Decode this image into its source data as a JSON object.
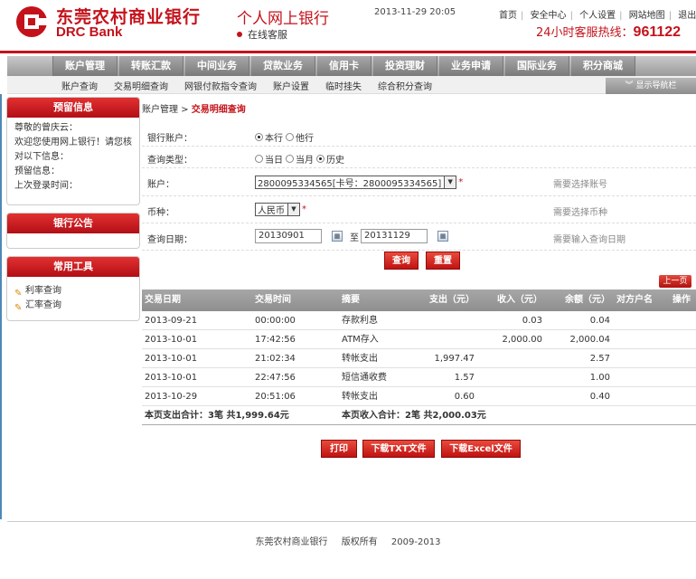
{
  "header": {
    "logo_cn": "东莞农村商业银行",
    "logo_en": "DRC Bank",
    "title": "个人网上银行",
    "online_service": "在线客服",
    "datetime": "2013-11-29  20:05",
    "links": [
      "首页",
      "安全中心",
      "个人设置",
      "网站地图",
      "退出"
    ],
    "hotline_label": "24小时客服热线：",
    "hotline_number": "961122"
  },
  "nav": [
    "账户管理",
    "转账汇款",
    "中间业务",
    "贷款业务",
    "信用卡",
    "投资理财",
    "业务申请",
    "国际业务",
    "积分商城"
  ],
  "subnav": [
    "账户查询",
    "交易明细查询",
    "网银付款指令查询",
    "账户设置",
    "临时挂失",
    "综合积分查询"
  ],
  "show_nav_label": "显示导航栏",
  "sidebar": {
    "reserved": {
      "title": "预留信息",
      "greeting": "尊敬的曾庆云：",
      "line1": "欢迎您使用网上银行！请您核",
      "line2": "对以下信息：",
      "line3": "预留信息：",
      "line4": "上次登录时间："
    },
    "notice_title": "银行公告",
    "tools": {
      "title": "常用工具",
      "items": [
        "利率查询",
        "汇率查询"
      ]
    }
  },
  "breadcrumb": {
    "parent": "账户管理 > ",
    "current": "交易明细查询"
  },
  "form": {
    "bank_account_label": "银行账户：",
    "bank_options": [
      "本行",
      "他行"
    ],
    "query_type_label": "查询类型：",
    "query_options": [
      "当日",
      "当月",
      "历史"
    ],
    "account_label": "账户：",
    "account_value": "2800095334565[卡号：2800095334565]",
    "account_hint": "需要选择账号",
    "currency_label": "币种：",
    "currency_value": "人民币",
    "currency_hint": "需要选择币种",
    "date_label": "查询日期：",
    "date_from": "20130901",
    "date_to_label": "至",
    "date_to": "20131129",
    "date_hint": "需要输入查询日期",
    "required_mark": "*",
    "query_btn": "查询",
    "reset_btn": "重置"
  },
  "prev_page": "上一页",
  "table": {
    "headers": [
      "交易日期",
      "交易时间",
      "摘要",
      "支出（元）",
      "收入（元）",
      "余额（元）",
      "对方户名",
      "操作"
    ],
    "rows": [
      [
        "2013-09-21",
        "00:00:00",
        "存款利息",
        "",
        "0.03",
        "0.04"
      ],
      [
        "2013-10-01",
        "17:42:56",
        "ATM存入",
        "",
        "2,000.00",
        "2,000.04"
      ],
      [
        "2013-10-01",
        "21:02:34",
        "转帐支出",
        "1,997.47",
        "",
        "2.57"
      ],
      [
        "2013-10-01",
        "22:47:56",
        "短信通收费",
        "1.57",
        "",
        "1.00"
      ],
      [
        "2013-10-29",
        "20:51:06",
        "转帐支出",
        "0.60",
        "",
        "0.40"
      ]
    ],
    "summary_out": "本页支出合计：3笔  共1,999.64元",
    "summary_in": "本页收入合计：2笔  共2,000.03元"
  },
  "actions": [
    "打印",
    "下载TXT文件",
    "下载Excel文件"
  ],
  "footer": [
    "东莞农村商业银行",
    "版权所有",
    "2009-2013"
  ]
}
